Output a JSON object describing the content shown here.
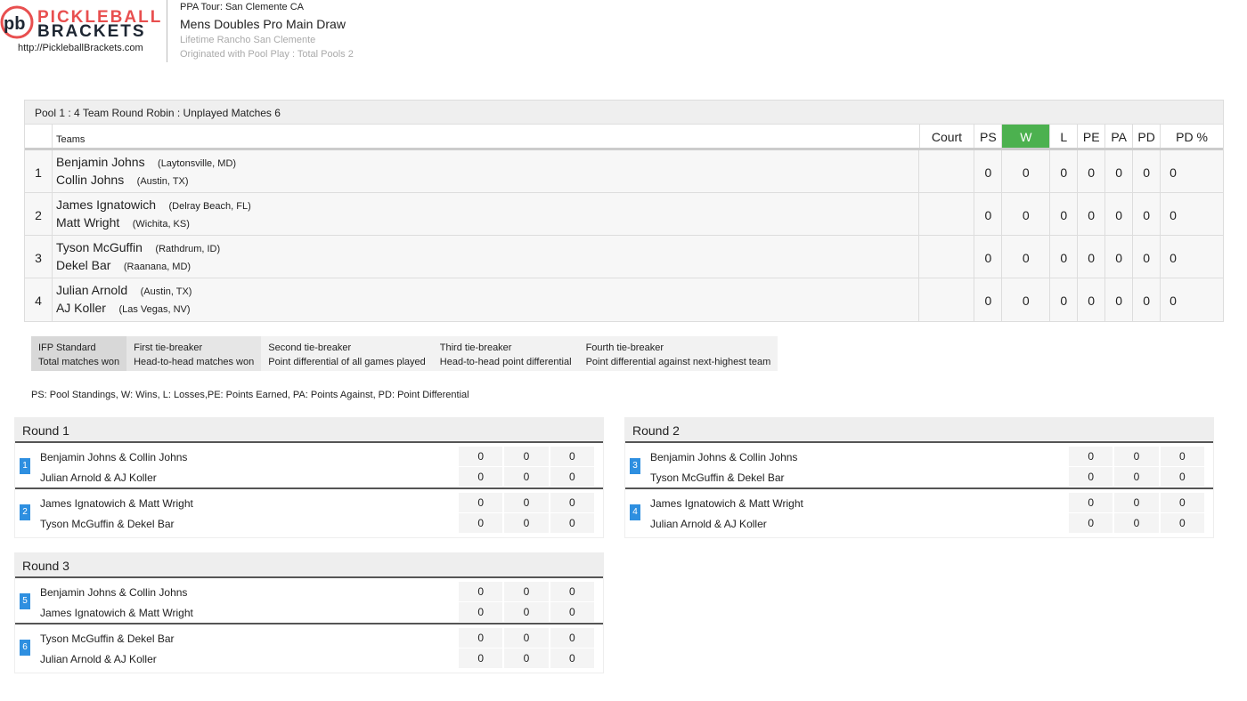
{
  "header": {
    "logo_line1": "PICKLEBALL",
    "logo_line2": "BRACKETS",
    "site_url": "http://PickleballBrackets.com",
    "tour": "PPA Tour: San Clemente CA",
    "title": "Mens Doubles Pro Main Draw",
    "venue": "Lifetime Rancho San Clemente",
    "origin": "Originated with Pool Play : Total Pools 2"
  },
  "pool": {
    "title": "Pool 1 : 4 Team Round Robin : Unplayed Matches 6",
    "columns": {
      "teams": "Teams",
      "court": "Court",
      "ps": "PS",
      "w": "W",
      "l": "L",
      "pe": "PE",
      "pa": "PA",
      "pd": "PD",
      "pdp": "PD %"
    },
    "colors": {
      "w_header": "#4cb14f"
    },
    "rows": [
      {
        "num": "1",
        "p1": "Benjamin Johns",
        "p1_loc": "(Laytonsville, MD)",
        "p2": "Collin Johns",
        "p2_loc": "(Austin, TX)",
        "ps": "0",
        "w": "0",
        "l": "0",
        "pe": "0",
        "pa": "0",
        "pd": "0",
        "pdp": "0"
      },
      {
        "num": "2",
        "p1": "James Ignatowich",
        "p1_loc": "(Delray Beach, FL)",
        "p2": "Matt Wright",
        "p2_loc": "(Wichita, KS)",
        "ps": "0",
        "w": "0",
        "l": "0",
        "pe": "0",
        "pa": "0",
        "pd": "0",
        "pdp": "0"
      },
      {
        "num": "3",
        "p1": "Tyson McGuffin",
        "p1_loc": "(Rathdrum, ID)",
        "p2": "Dekel Bar",
        "p2_loc": "(Raanana, MD)",
        "ps": "0",
        "w": "0",
        "l": "0",
        "pe": "0",
        "pa": "0",
        "pd": "0",
        "pdp": "0"
      },
      {
        "num": "4",
        "p1": "Julian Arnold",
        "p1_loc": "(Austin, TX)",
        "p2": "AJ Koller",
        "p2_loc": "(Las Vegas, NV)",
        "ps": "0",
        "w": "0",
        "l": "0",
        "pe": "0",
        "pa": "0",
        "pd": "0",
        "pdp": "0"
      }
    ]
  },
  "tiebreakers": [
    {
      "title": "IFP Standard",
      "desc": "Total matches won"
    },
    {
      "title": "First tie-breaker",
      "desc": "Head-to-head matches won"
    },
    {
      "title": "Second tie-breaker",
      "desc": "Point differential of all games played"
    },
    {
      "title": "Third tie-breaker",
      "desc": "Head-to-head point differential"
    },
    {
      "title": "Fourth tie-breaker",
      "desc": "Point differential against next-highest team"
    }
  ],
  "legend": "PS: Pool Standings, W: Wins, L: Losses,PE: Points Earned, PA: Points Against, PD: Point Differential",
  "rounds": [
    {
      "title": "Round 1",
      "matches": [
        {
          "num": "1",
          "team1": "Benjamin Johns & Collin Johns",
          "team2": "Julian Arnold & AJ Koller",
          "s1": [
            "0",
            "0",
            "0"
          ],
          "s2": [
            "0",
            "0",
            "0"
          ]
        },
        {
          "num": "2",
          "team1": "James Ignatowich & Matt Wright",
          "team2": "Tyson McGuffin & Dekel Bar",
          "s1": [
            "0",
            "0",
            "0"
          ],
          "s2": [
            "0",
            "0",
            "0"
          ]
        }
      ]
    },
    {
      "title": "Round 2",
      "matches": [
        {
          "num": "3",
          "team1": "Benjamin Johns & Collin Johns",
          "team2": "Tyson McGuffin & Dekel Bar",
          "s1": [
            "0",
            "0",
            "0"
          ],
          "s2": [
            "0",
            "0",
            "0"
          ]
        },
        {
          "num": "4",
          "team1": "James Ignatowich & Matt Wright",
          "team2": "Julian Arnold & AJ Koller",
          "s1": [
            "0",
            "0",
            "0"
          ],
          "s2": [
            "0",
            "0",
            "0"
          ]
        }
      ]
    },
    {
      "title": "Round 3",
      "matches": [
        {
          "num": "5",
          "team1": "Benjamin Johns & Collin Johns",
          "team2": "James Ignatowich & Matt Wright",
          "s1": [
            "0",
            "0",
            "0"
          ],
          "s2": [
            "0",
            "0",
            "0"
          ]
        },
        {
          "num": "6",
          "team1": "Tyson McGuffin & Dekel Bar",
          "team2": "Julian Arnold & AJ Koller",
          "s1": [
            "0",
            "0",
            "0"
          ],
          "s2": [
            "0",
            "0",
            "0"
          ]
        }
      ]
    }
  ]
}
